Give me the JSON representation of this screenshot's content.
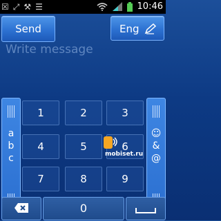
{
  "status": {
    "time": "10:46"
  },
  "toolbar": {
    "send_label": "Send",
    "lang_label": "Eng"
  },
  "message": {
    "placeholder": "Write message"
  },
  "keypad": {
    "rows": [
      [
        "1",
        "2",
        "3"
      ],
      [
        "4",
        "5",
        "6"
      ],
      [
        "7",
        "8",
        "9"
      ]
    ],
    "left_mode": [
      "a",
      "b",
      "c"
    ],
    "right_mode": [
      "☺",
      "&",
      "@"
    ],
    "zero": "0"
  },
  "overlay": {
    "watermark": "mobiset.ru"
  },
  "icons": [
    "wifi-icon",
    "signal-icon",
    "battery-icon",
    "pen-icon",
    "backspace-icon",
    "space-icon",
    "mobiset-logo-icon"
  ]
}
